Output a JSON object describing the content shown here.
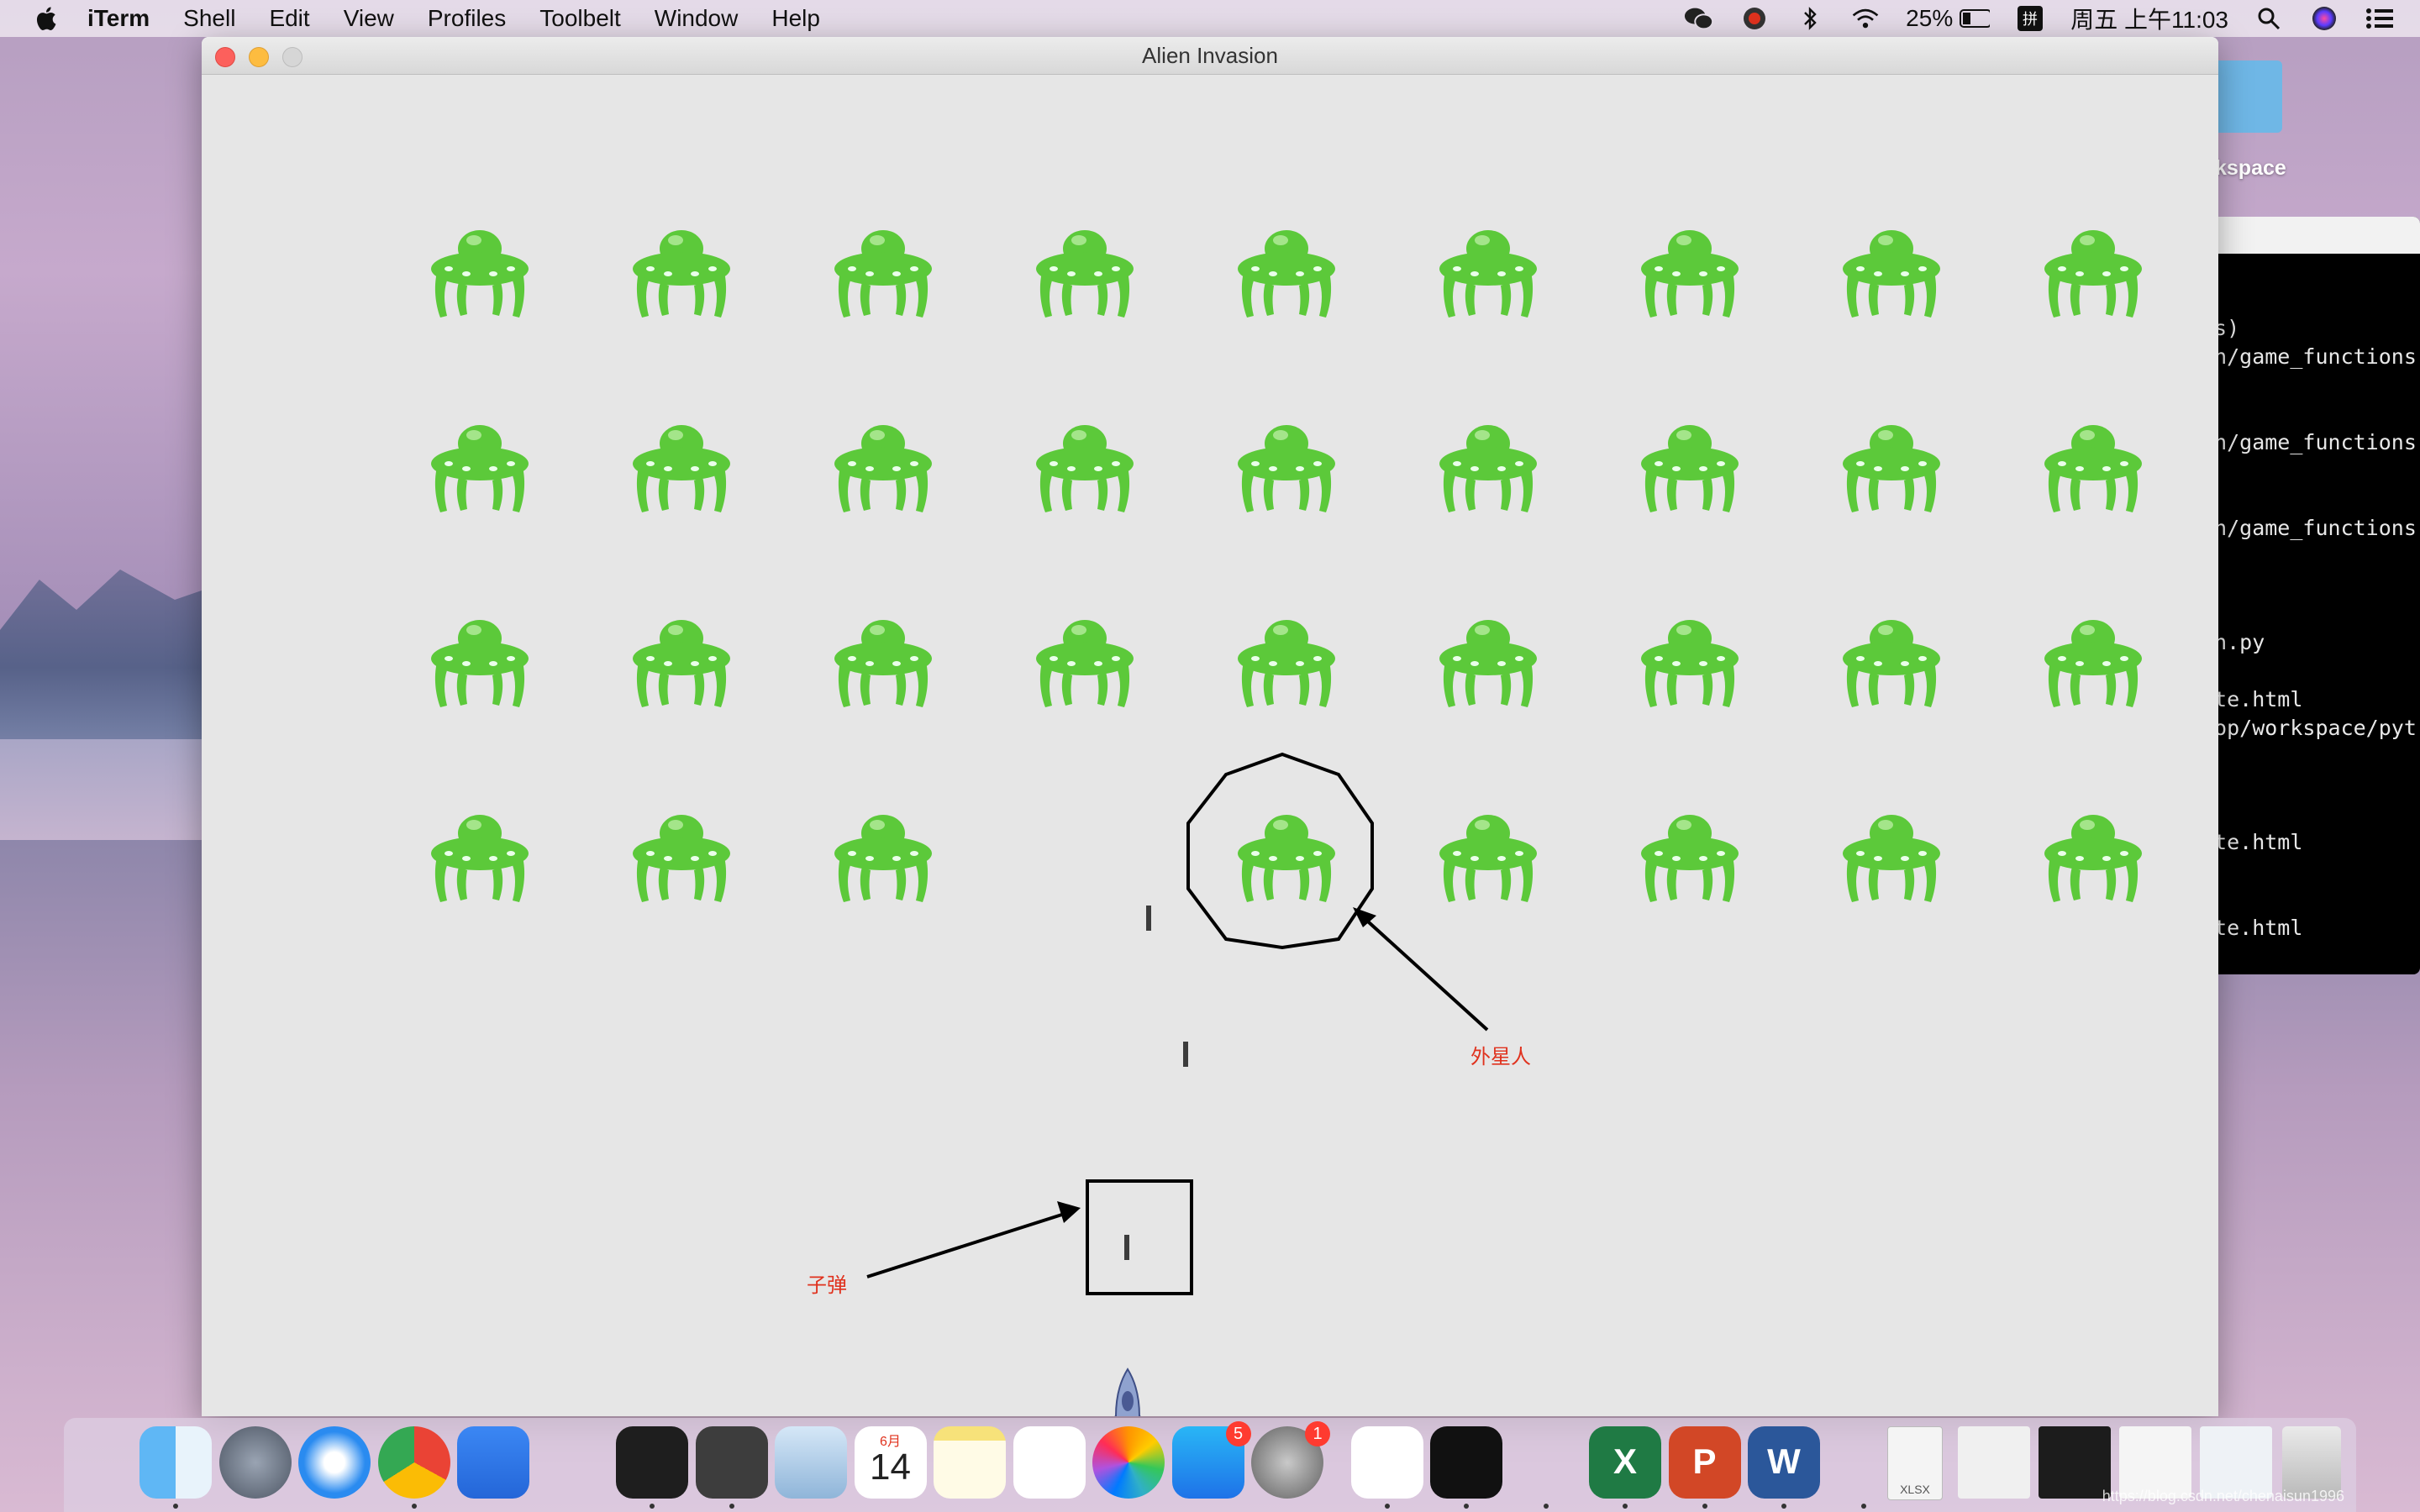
{
  "menubar": {
    "app_name": "iTerm",
    "items": [
      "Shell",
      "Edit",
      "View",
      "Profiles",
      "Toolbelt",
      "Window",
      "Help"
    ],
    "battery": "25%",
    "datetime": "周五 上午11:03"
  },
  "desktop": {
    "folder_label": "kspace",
    "terminal_lines": [
      "ts)",
      "on/game_functions",
      "on/game_functions",
      "on/game_functions",
      "on.py",
      "ute.html",
      "top/workspace/pyt",
      "/",
      "ute.html",
      "/",
      "ute.html"
    ]
  },
  "window": {
    "title": "Alien Invasion"
  },
  "game": {
    "alien_rows": 4,
    "alien_cols": 9,
    "alien_color": "#5cc93a",
    "missing_aliens": [
      [
        3,
        3
      ],
      [
        3,
        4
      ]
    ],
    "annotations": {
      "alien_label": "外星人",
      "bullet_label": "子弹"
    }
  },
  "dock": {
    "apps": [
      "finder-icon",
      "launchpad-icon",
      "safari-icon",
      "chrome-icon",
      "wps-icon",
      "qq-icon",
      "terminal-icon",
      "sublime-icon",
      "mail-icon",
      "calendar-icon",
      "notes-icon",
      "reminders-icon",
      "photos-icon",
      "appstore-icon",
      "system-preferences-icon",
      "baidu-netdisk-icon",
      "iterm-icon",
      "wechat-icon",
      "excel-icon",
      "powerpoint-icon",
      "word-icon",
      "python-icon"
    ],
    "calendar_month": "6月",
    "calendar_day": "14",
    "appstore_badge": "5",
    "sysprefs_badge": "1",
    "excel_letter": "X",
    "powerpoint_letter": "P",
    "word_letter": "W",
    "xlsx_label": "XLSX",
    "watermark": "https://blog.csdn.net/chenaisun1996"
  }
}
